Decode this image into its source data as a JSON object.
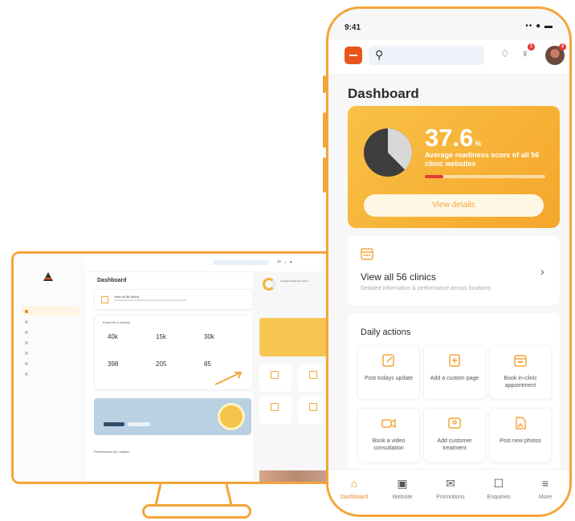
{
  "colors": {
    "accent": "#f4a53a",
    "brand": "#e8541c",
    "alert": "#e53935",
    "banner_blue": "#b9d1e3"
  },
  "phone": {
    "status": {
      "time": "9:41",
      "icons": "•• ● ▬"
    },
    "header": {
      "logo_icon": "logo-icon",
      "search_icon": "search-icon",
      "bell_icon": "bell-icon",
      "megaphone_icon": "megaphone-icon",
      "megaphone_count": "1",
      "avatar_count": "3"
    },
    "page_title": "Dashboard",
    "hero": {
      "score": "37.6",
      "score_unit": "%",
      "description": "Average readiness score of all 56 clinic websites",
      "progress": 0.15,
      "button": "View details"
    },
    "clinics": {
      "title": "View all 56 clinics",
      "subtitle": "Detailed information & performance across locations",
      "icon": "calendar-icon"
    },
    "daily": {
      "title": "Daily actions",
      "tiles": [
        {
          "label": "Post todays update",
          "icon": "edit-icon"
        },
        {
          "label": "Add a custom page",
          "icon": "page-add-icon"
        },
        {
          "label": "Book in-clinic appointment",
          "icon": "calendar-book-icon"
        },
        {
          "label": "Book a video consultation",
          "icon": "video-icon"
        },
        {
          "label": "Add customer treatment",
          "icon": "treatment-icon"
        },
        {
          "label": "Post new photos",
          "icon": "photo-icon"
        }
      ]
    },
    "tabs": [
      {
        "label": "Dashboard",
        "icon": "home-icon",
        "glyph": "⌂",
        "active": true
      },
      {
        "label": "Website",
        "icon": "website-icon",
        "glyph": "▣",
        "active": false
      },
      {
        "label": "Promotions",
        "icon": "megaphone-icon",
        "glyph": "✉",
        "active": false
      },
      {
        "label": "Enquiries",
        "icon": "inbox-icon",
        "glyph": "☐",
        "active": false
      },
      {
        "label": "More",
        "icon": "menu-icon",
        "glyph": "≡",
        "active": false
      }
    ]
  },
  "desktop": {
    "title": "Dashboard",
    "clinics_title": "View all 56 clinics",
    "stats_heading": "Enquiries & Activity",
    "stats": [
      {
        "value": "40k"
      },
      {
        "value": "15k"
      },
      {
        "value": "30k"
      },
      {
        "value": "398"
      },
      {
        "value": "205"
      },
      {
        "value": "85"
      }
    ],
    "performance_heading": "Performance by Location",
    "readiness_label": "Average Readiness Score"
  }
}
